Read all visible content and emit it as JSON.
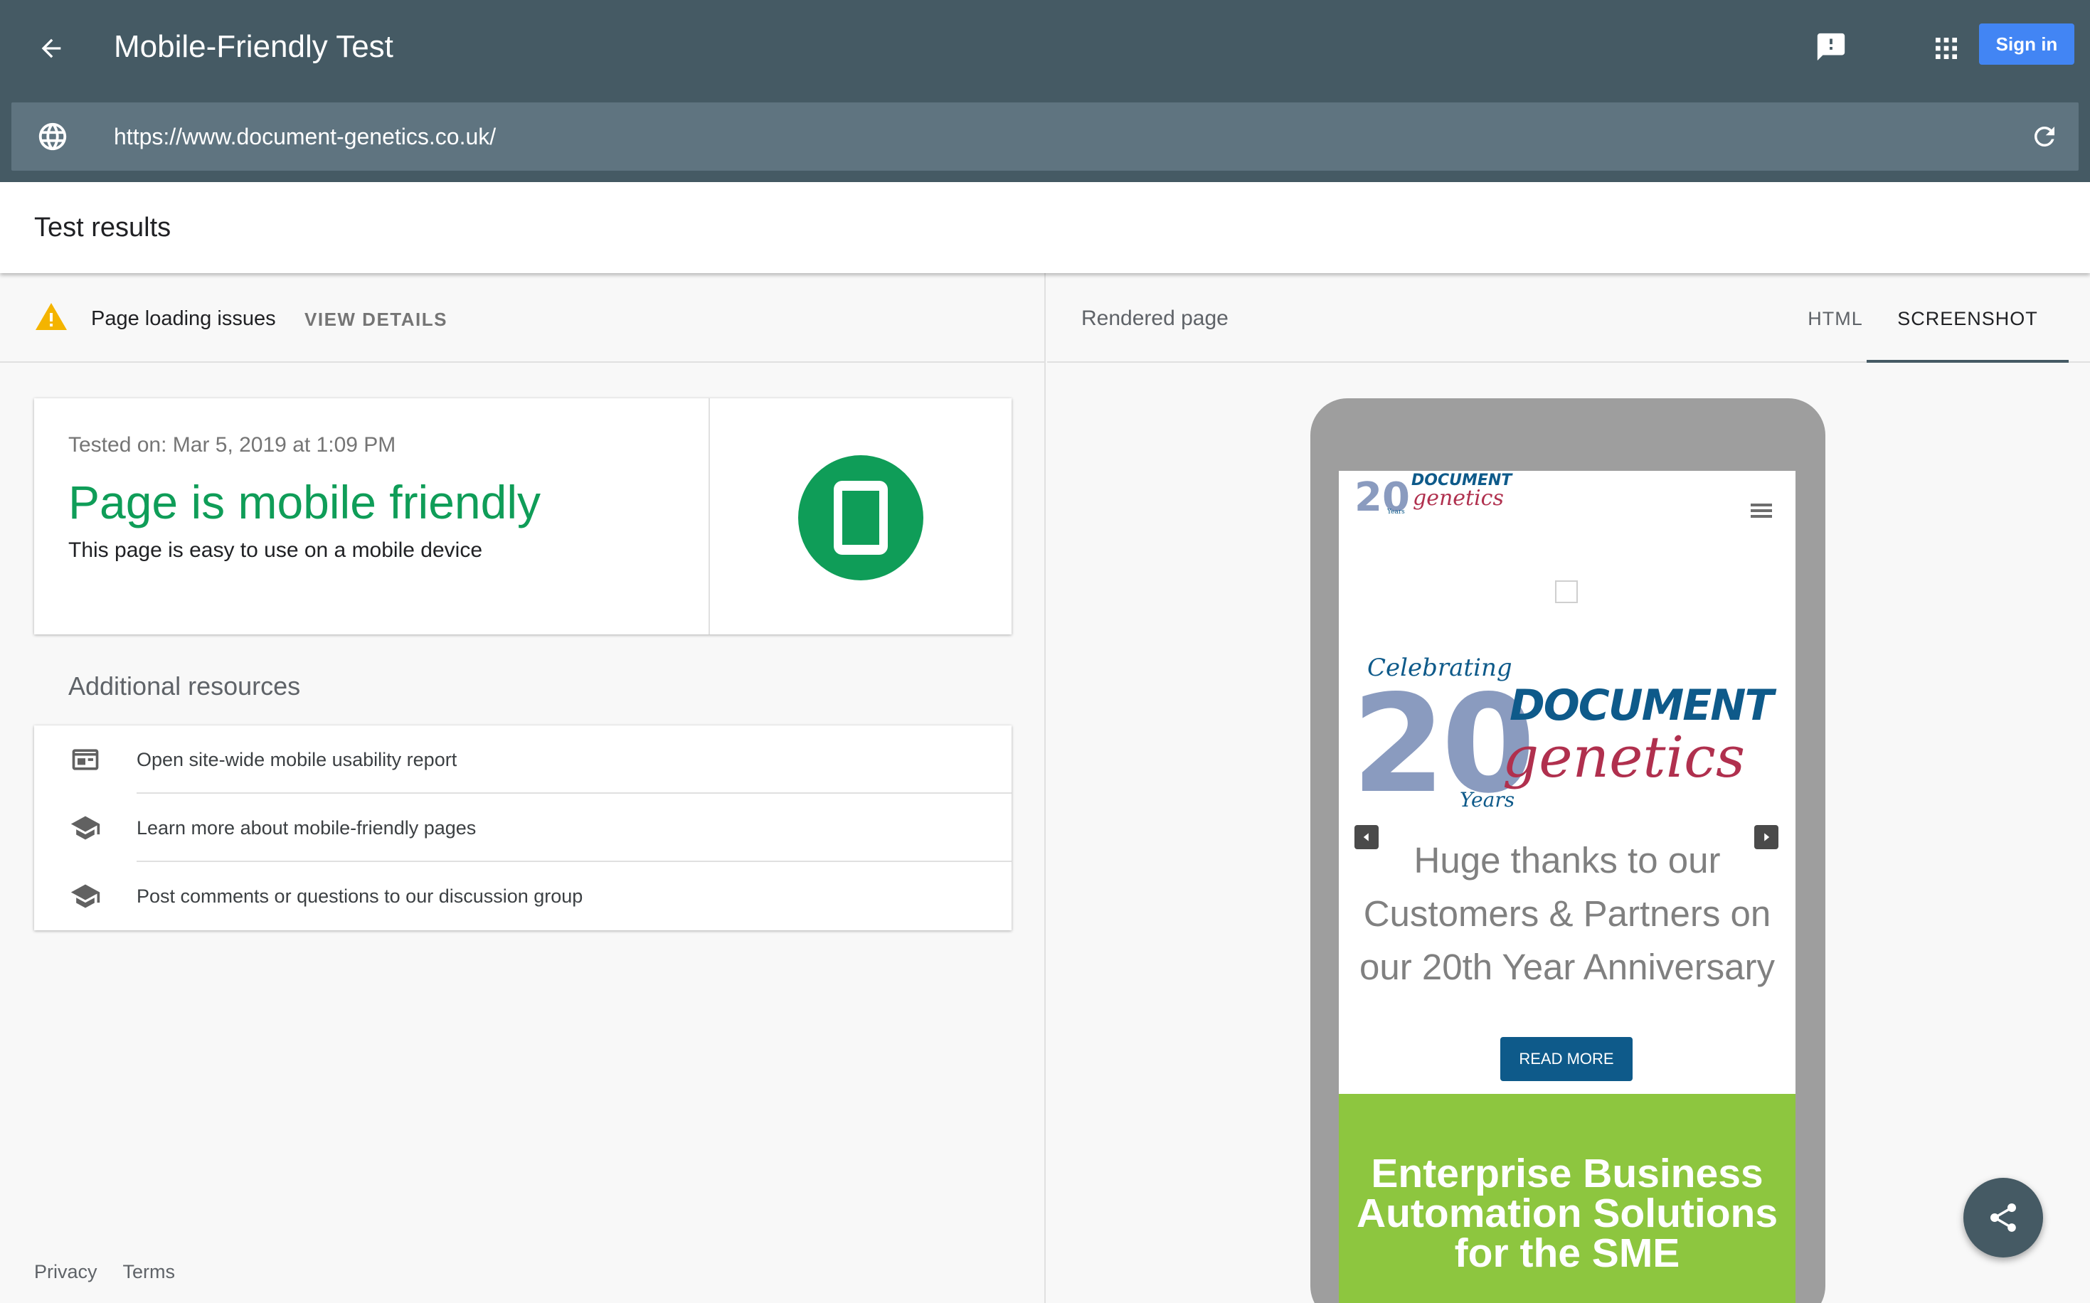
{
  "header": {
    "title": "Mobile-Friendly Test",
    "signin_label": "Sign in",
    "url": "https://www.document-genetics.co.uk/",
    "icons": [
      "back-arrow-icon",
      "feedback-icon",
      "apps-grid-icon",
      "globe-icon",
      "refresh-icon"
    ]
  },
  "results": {
    "title": "Test results",
    "issues_label": "Page loading issues",
    "view_details_label": "VIEW DETAILS",
    "tested_on": "Tested on: Mar 5, 2019 at 1:09 PM",
    "verdict": "Page is mobile friendly",
    "description": "This page is easy to use on a mobile device",
    "verdict_color": "#0f9d58",
    "warning_color": "#f4b400"
  },
  "resources": {
    "title": "Additional resources",
    "items": [
      {
        "label": "Open site-wide mobile usability report",
        "icon": "report-icon"
      },
      {
        "label": "Learn more about mobile-friendly pages",
        "icon": "school-icon"
      },
      {
        "label": "Post comments or questions to our discussion group",
        "icon": "school-icon"
      }
    ]
  },
  "footer": {
    "privacy": "Privacy",
    "terms": "Terms"
  },
  "rendered": {
    "title": "Rendered page",
    "tab_html": "HTML",
    "tab_screenshot": "SCREENSHOT",
    "active_tab": "SCREENSHOT"
  },
  "preview": {
    "logo_number": "20",
    "logo_years": "Years",
    "logo_document": "DOCUMENT",
    "logo_genetics": "genetics",
    "hero_celebrating": "Celebrating",
    "hero_number": "20",
    "hero_years": "Years",
    "hero_document": "DOCUMENT",
    "hero_genetics": "genetics",
    "thanks": "Huge thanks to our\nCustomers & Partners on\nour 20th Year Anniversary",
    "read_more": "READ MORE",
    "banner": "Enterprise Business\nAutomation Solutions\nfor the SME",
    "brand_blue": "#0e5a8a",
    "brand_red": "#b0304e",
    "banner_green": "#8dc63f"
  }
}
